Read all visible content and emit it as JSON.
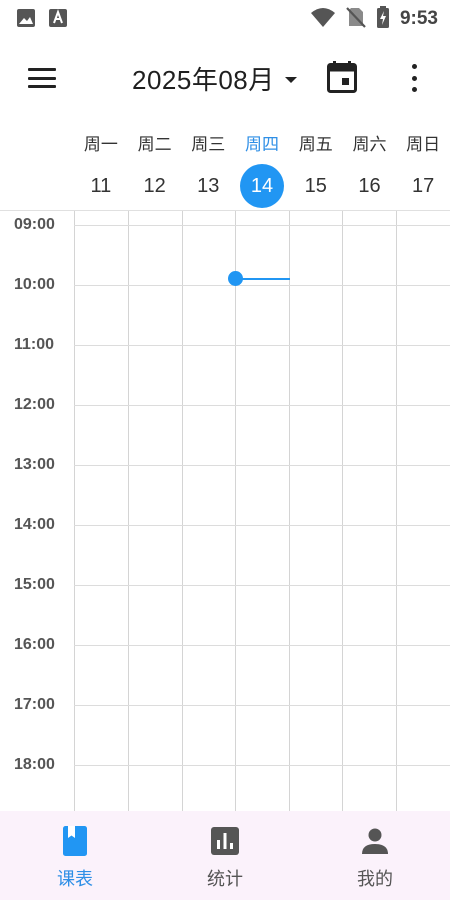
{
  "status_bar": {
    "time": "9:53",
    "left_icons": [
      "image-icon",
      "font-download-icon"
    ],
    "right_icons": [
      "wifi-icon",
      "no-sim-icon",
      "battery-charging-icon"
    ]
  },
  "app_bar": {
    "title": "2025年08月",
    "icons": [
      "menu-icon",
      "dropdown-caret-icon",
      "calendar-icon",
      "more-vert-icon"
    ]
  },
  "week": {
    "days": [
      {
        "name": "周一",
        "num": "11"
      },
      {
        "name": "周二",
        "num": "12"
      },
      {
        "name": "周三",
        "num": "13"
      },
      {
        "name": "周四",
        "num": "14"
      },
      {
        "name": "周五",
        "num": "15"
      },
      {
        "name": "周六",
        "num": "16"
      },
      {
        "name": "周日",
        "num": "17"
      }
    ],
    "today_index": 3
  },
  "schedule": {
    "times": [
      "09:00",
      "10:00",
      "11:00",
      "12:00",
      "13:00",
      "14:00",
      "15:00",
      "16:00",
      "17:00",
      "18:00"
    ]
  },
  "bottom_nav": {
    "items": [
      {
        "label": "课表",
        "icon": "book-icon"
      },
      {
        "label": "统计",
        "icon": "bar-chart-icon"
      },
      {
        "label": "我的",
        "icon": "person-icon"
      }
    ],
    "active_index": 0
  },
  "colors": {
    "accent": "#2196f3",
    "nav_background": "#fbf2fb"
  }
}
